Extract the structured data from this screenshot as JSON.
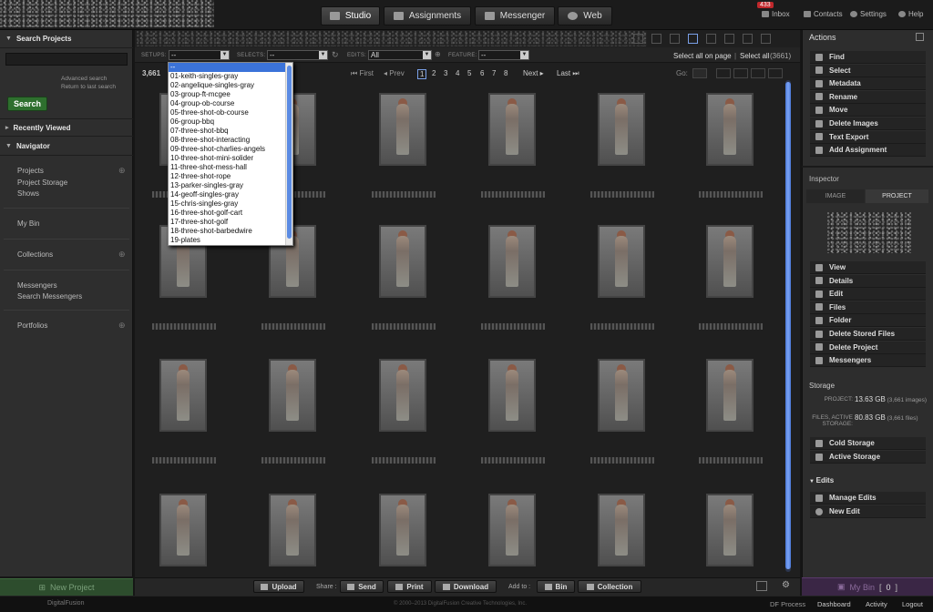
{
  "nav": {
    "tabs": [
      {
        "label": "Studio",
        "icon": "studio-icon",
        "active": true
      },
      {
        "label": "Assignments",
        "icon": "assignments-icon",
        "active": false
      },
      {
        "label": "Messenger",
        "icon": "messenger-icon",
        "active": false
      },
      {
        "label": "Web",
        "icon": "globe-icon",
        "active": false
      }
    ],
    "inbox_label": "Inbox",
    "inbox_count": "433",
    "contacts_label": "Contacts",
    "settings_label": "Settings",
    "help_label": "Help"
  },
  "left": {
    "search_header": "Search Projects",
    "search_value": "",
    "advanced_search": "Advanced search",
    "return_search": "Return to last search",
    "search_button": "Search",
    "recently_viewed": "Recently Viewed",
    "navigator": "Navigator",
    "projects": "Projects",
    "project_storage": "Project Storage",
    "shows": "Shows",
    "my_bin": "My Bin",
    "collections": "Collections",
    "messengers": "Messengers",
    "search_messengers": "Search Messengers",
    "portfolios": "Portfolios",
    "new_project": "New Project"
  },
  "filters": {
    "setups_label": "SETUPS:",
    "setups_value": "--",
    "selects_label": "SELECTS:",
    "selects_value": "--",
    "edits_label": "EDITS:",
    "edits_value": "All",
    "feature_label": "FEATURE:",
    "feature_value": "--",
    "select_all_page": "Select all on page",
    "select_all": "Select all",
    "select_all_count": "(3661)"
  },
  "pager": {
    "count": "3,661",
    "first": "First",
    "prev": "Prev",
    "pages": [
      "1",
      "2",
      "3",
      "4",
      "5",
      "6",
      "7",
      "8"
    ],
    "current": "1",
    "next": "Next",
    "last": "Last",
    "go_label": "Go:"
  },
  "setups_options": [
    "--",
    "01-keith-singles-gray",
    "02-angelique-singles-gray",
    "03-group-ft-mcgee",
    "04-group-ob-course",
    "05-three-shot-ob-course",
    "06-group-bbq",
    "07-three-shot-bbq",
    "08-three-shot-interacting",
    "09-three-shot-charlies-angels",
    "10-three-shot-mini-solider",
    "11-three-shot-mess-hall",
    "12-three-shot-rope",
    "13-parker-singles-gray",
    "14-geoff-singles-gray",
    "15-chris-singles-gray",
    "16-three-shot-golf-cart",
    "17-three-shot-golf",
    "18-three-shot-barbedwire",
    "19-plates"
  ],
  "bottom": {
    "upload": "Upload",
    "share_label": "Share :",
    "send": "Send",
    "print": "Print",
    "download": "Download",
    "add_to_label": "Add to :",
    "bin": "Bin",
    "collection": "Collection",
    "my_bin": "My Bin",
    "my_bin_count": "0"
  },
  "actions": {
    "title": "Actions",
    "items": [
      "Find",
      "Select",
      "Metadata",
      "Rename",
      "Move",
      "Delete Images",
      "Text Export",
      "Add Assignment"
    ]
  },
  "inspector": {
    "title": "Inspector",
    "tab_image": "IMAGE",
    "tab_project": "PROJECT",
    "items": [
      "View",
      "Details",
      "Edit",
      "Files",
      "Folder",
      "Delete Stored Files",
      "Delete Project",
      "Messengers"
    ]
  },
  "storage": {
    "title": "Storage",
    "project_label": "PROJECT:",
    "project_value": "13.63 GB",
    "project_note": "(3,661 images)",
    "files_label": "FILES, ACTIVE STORAGE:",
    "files_value": "80.83 GB",
    "files_note": "(3,661 files)",
    "cold": "Cold Storage",
    "active": "Active Storage"
  },
  "edits": {
    "title": "Edits",
    "manage": "Manage Edits",
    "new": "New Edit"
  },
  "footer": {
    "brand": "DigitalFusion",
    "copyright": "© 2000–2013 DigitalFusion Creative Technologies, Inc.",
    "df_process": "DF Process",
    "dashboard": "Dashboard",
    "activity": "Activity",
    "logout": "Logout"
  },
  "colors": {
    "accent": "#3b73d9",
    "search_button": "#2e6f2e",
    "badge": "#c0282c",
    "my_bin": "#4a2a5a"
  }
}
